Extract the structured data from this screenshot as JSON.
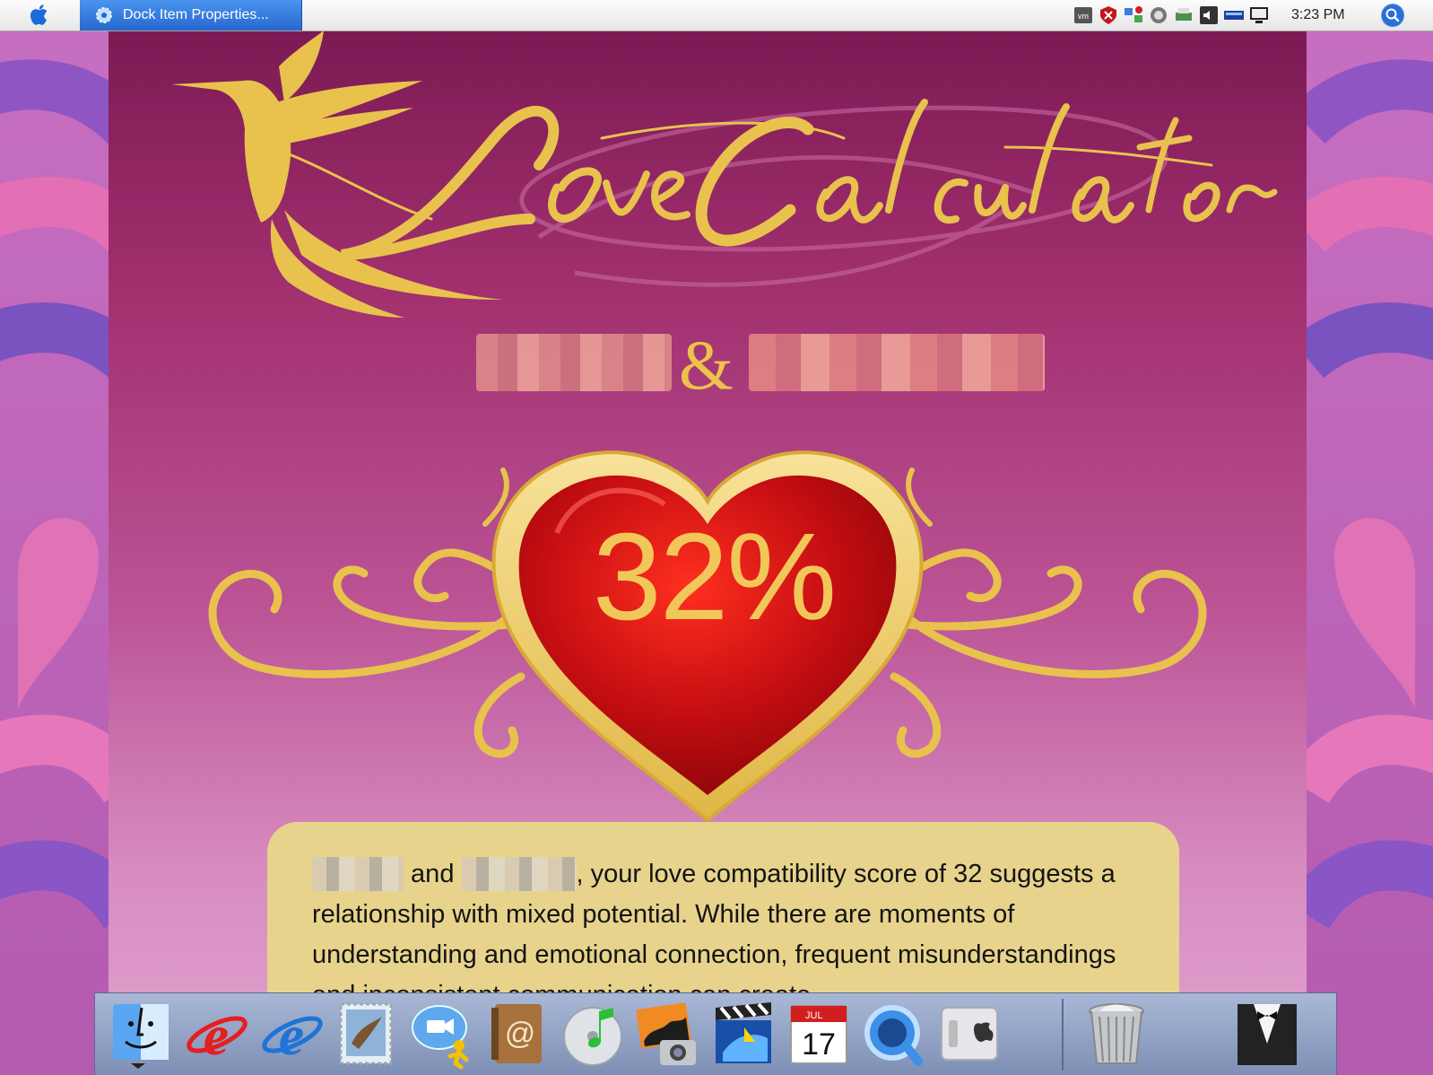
{
  "menubar": {
    "task_button_label": "Dock Item Properties...",
    "clock": "3:23 PM",
    "tray_icons": [
      "vm-icon",
      "security-shield-icon",
      "network-icon",
      "sync-icon",
      "printer-icon",
      "volume-icon",
      "battery-icon",
      "display-icon"
    ]
  },
  "page": {
    "title": "Love Calculator",
    "ampersand": "&",
    "percent_text": "32%",
    "score_percent": 32,
    "result": {
      "and": " and ",
      "comma": ",",
      "text": " your love compatibility score of 32 suggests a relationship with mixed potential. While there are moments of understanding and emotional connection, frequent misunderstandings and inconsistent communication can create"
    }
  },
  "dock": {
    "items": [
      "finder-icon",
      "browser-e-icon",
      "internet-explorer-icon",
      "mail-stamp-icon",
      "ichat-icon",
      "address-book-icon",
      "itunes-icon",
      "iphoto-icon",
      "imovie-icon",
      "ical-icon",
      "quicktime-icon",
      "system-preferences-icon",
      "trash-icon",
      "tuxedo-icon"
    ],
    "ical_month": "JUL",
    "ical_day": "17"
  },
  "colors": {
    "menubar_accent": "#2d6fd6",
    "page_top": "#7c1a54",
    "page_bottom": "#e0a4cf",
    "gold": "#ecc34a",
    "heart_red": "#c70f14",
    "result_box": "#e8d38d"
  }
}
